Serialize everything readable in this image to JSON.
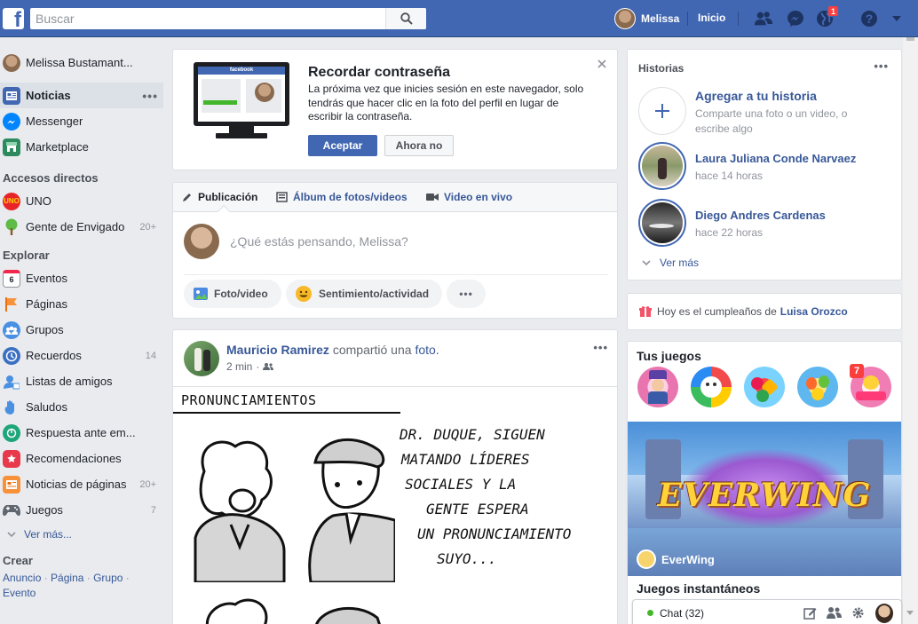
{
  "topbar": {
    "logo": "f",
    "search_placeholder": "Buscar",
    "user_name": "Melissa",
    "home_label": "Inicio",
    "notification_count": "1"
  },
  "leftnav": {
    "profile_name": "Melissa Bustamant...",
    "items": [
      {
        "label": "Noticias",
        "active": true
      },
      {
        "label": "Messenger"
      },
      {
        "label": "Marketplace"
      }
    ],
    "shortcuts_heading": "Accesos directos",
    "shortcuts": [
      {
        "label": "UNO"
      },
      {
        "label": "Gente de Envigado",
        "count": "20+"
      }
    ],
    "explore_heading": "Explorar",
    "explore": [
      {
        "label": "Eventos",
        "icon_text": "6"
      },
      {
        "label": "Páginas"
      },
      {
        "label": "Grupos"
      },
      {
        "label": "Recuerdos",
        "count": "14"
      },
      {
        "label": "Listas de amigos"
      },
      {
        "label": "Saludos"
      },
      {
        "label": "Respuesta ante em..."
      },
      {
        "label": "Recomendaciones"
      },
      {
        "label": "Noticias de páginas",
        "count": "20+"
      },
      {
        "label": "Juegos",
        "count": "7"
      }
    ],
    "see_more": "Ver más...",
    "create_heading": "Crear",
    "create_links": [
      "Anuncio",
      "Página",
      "Grupo",
      "Evento"
    ]
  },
  "password_card": {
    "title": "Recordar contraseña",
    "body": "La próxima vez que inicies sesión en este navegador, solo tendrás que hacer clic en la foto del perfil en lugar de escribir la contraseña.",
    "accept": "Aceptar",
    "decline": "Ahora no",
    "illustration_brand": "facebook"
  },
  "composer": {
    "tabs": [
      "Publicación",
      "Álbum de fotos/videos",
      "Video en vivo"
    ],
    "placeholder": "¿Qué estás pensando, Melissa?",
    "actions": [
      "Foto/video",
      "Sentimiento/actividad"
    ]
  },
  "post": {
    "author": "Mauricio Ramirez",
    "shared": "compartió una",
    "object": "foto.",
    "time": "2 min",
    "comic_title": "PRONUNCIAMIENTOS",
    "comic_text": [
      "DR. DUQUE, SIGUEN",
      "MATANDO LÍDERES",
      "SOCIALES Y LA",
      "GENTE ESPERA",
      "UN PRONUNCIAMIENTO",
      "SUYO..."
    ]
  },
  "stories": {
    "title": "Historias",
    "add_title": "Agregar a tu historia",
    "add_sub": "Comparte una foto o un video, o escribe algo",
    "items": [
      {
        "name": "Laura Juliana Conde Narvaez",
        "time": "hace 14 horas"
      },
      {
        "name": "Diego Andres Cardenas",
        "time": "hace 22 horas"
      }
    ],
    "see_more": "Ver más"
  },
  "birthday": {
    "text": "Hoy es el cumpleaños de",
    "name": "Luisa Orozco"
  },
  "games": {
    "title": "Tus juegos",
    "badge": "7",
    "featured_name": "EverWing",
    "featured_logo": "EVERWING",
    "instant_title": "Juegos instantáneos"
  },
  "chat": {
    "label": "Chat (32)"
  },
  "colors": {
    "brand": "#4267b2",
    "link": "#385898",
    "background": "#e9ebee"
  }
}
